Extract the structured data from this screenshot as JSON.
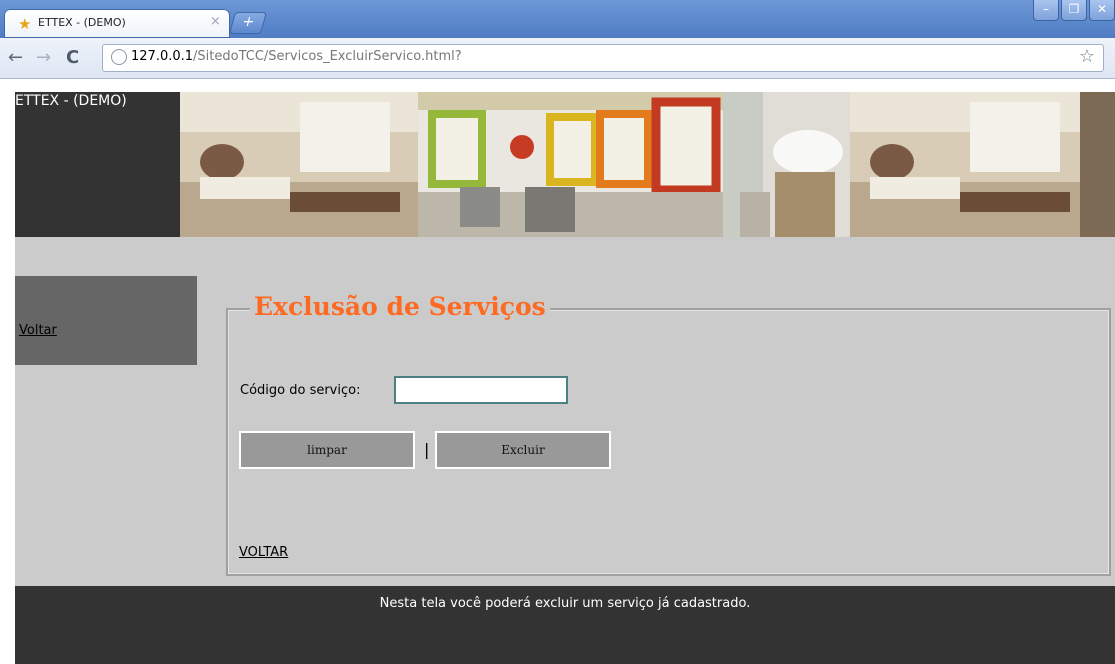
{
  "browser": {
    "tab_title": "ETTEX - (DEMO)",
    "tab_close": "×",
    "new_tab": "+",
    "url_host": "127.0.0.1",
    "url_path": "/SitedoTCC/Servicos_ExcluirServico.html?",
    "window_buttons": [
      "–",
      "❐",
      "✕"
    ]
  },
  "header": {
    "brand": "ETTEX - (DEMO)"
  },
  "sidebar": {
    "voltar_label": "Voltar"
  },
  "form": {
    "legend": "Exclusão de Serviços",
    "code_label": "Código do serviço:",
    "code_value": "",
    "limpar_label": "limpar",
    "separator": "|",
    "excluir_label": "Excluir",
    "voltar_label": "VOLTAR"
  },
  "footer": {
    "text": "Nesta tela você poderá excluir um serviço já cadastrado."
  },
  "colors": {
    "legend": "#ff6a22",
    "dark": "#333333",
    "panel": "#cbcbcb",
    "sidebar": "#666666"
  }
}
